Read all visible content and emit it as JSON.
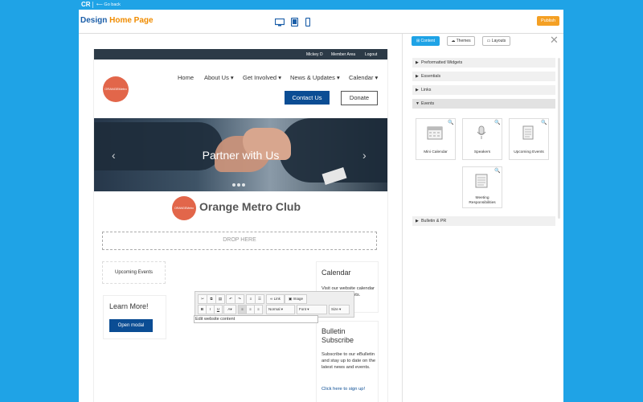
{
  "topbar": {
    "brand": "CR",
    "back": "Go back"
  },
  "header": {
    "title_prefix": "Design",
    "title_page": "Home Page",
    "publish_label": "Publish",
    "devices": [
      "desktop-icon",
      "tablet-icon",
      "mobile-icon"
    ]
  },
  "site": {
    "util_links": [
      "Mickey D",
      "Member Area",
      "Logout"
    ],
    "logo_text": "ORANGEMetro",
    "nav": [
      "Home",
      "About Us ▾",
      "Get Involved ▾",
      "News & Updates ▾",
      "Calendar ▾"
    ],
    "contact_label": "Contact Us",
    "donate_label": "Donate",
    "hero_title": "Partner with Us",
    "org_name": "Orange Metro Club",
    "drop_here": "DROP HERE",
    "upcoming_events": "Upcoming Events",
    "learn": {
      "heading": "Learn More!",
      "button": "Open modal"
    },
    "calendar": {
      "heading": "Calendar",
      "text": "Visit our website calendar to view our events."
    },
    "bulletin": {
      "heading": "Bulletin Subscribe",
      "text": "Subscribe to our eBulletin and stay up to date on the latest news and events.",
      "link": "Click here to sign up!"
    }
  },
  "editor": {
    "link": "Link",
    "image": "Image",
    "format": "Normal",
    "font": "Font",
    "size": "Size",
    "bold": "B",
    "italic": "I",
    "underline": "U",
    "color": "A",
    "field_text": "Edit website content"
  },
  "panel": {
    "tabs": [
      "Content",
      "Themes",
      "Layouts"
    ],
    "sections": [
      "Preformatted Widgets",
      "Essentials",
      "Links",
      "Events",
      "Bulletin & PR"
    ],
    "widgets": [
      "Mini Calendar",
      "Speakers",
      "Upcoming Events",
      "Meeting Responsibilities"
    ]
  },
  "colors": {
    "accent": "#1fa3e6",
    "brand_blue": "#0b4d94",
    "brand_orange": "#e2664a",
    "publish": "#f4a024"
  }
}
